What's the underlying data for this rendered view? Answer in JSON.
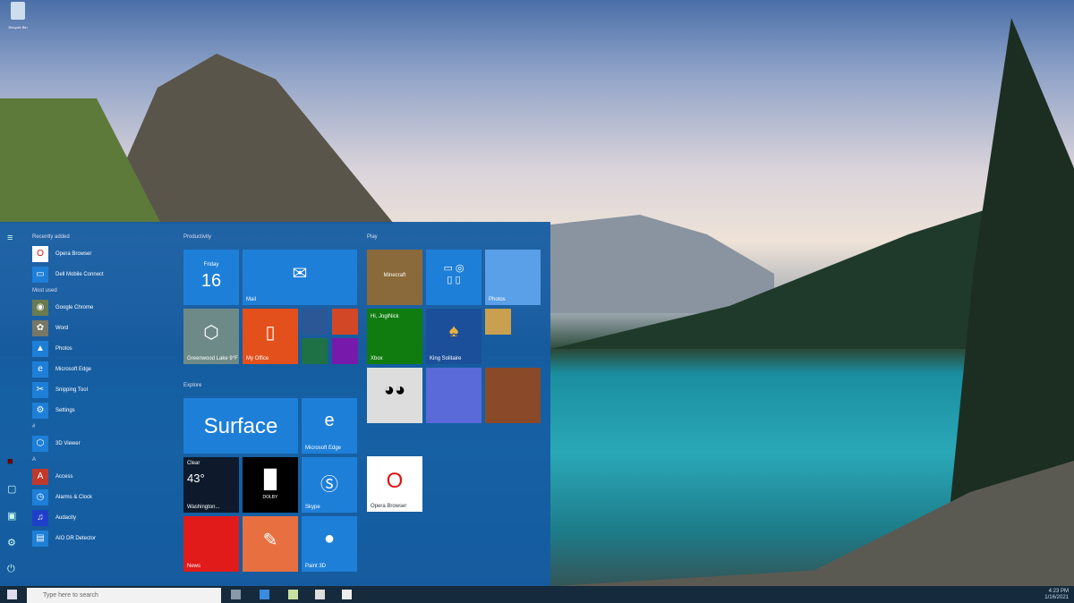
{
  "desktop": {
    "recycle_bin": "Recycle Bin"
  },
  "start_menu": {
    "recently_added_label": "Recently added",
    "recently_added": [
      "Opera Browser",
      "Dell Mobile Connect"
    ],
    "most_used_label": "Most used",
    "most_used": [
      "Google Chrome",
      "Word",
      "Photos",
      "Microsoft Edge",
      "Snipping Tool",
      "Settings"
    ],
    "letter_3": "#",
    "hash_items": [
      "3D Viewer"
    ],
    "letter_a": "A",
    "a_items": [
      "Access",
      "Alarms & Clock",
      "Audacity",
      "AIO DR Detector"
    ],
    "groups": {
      "productivity": "Productivity",
      "explore": "Explore",
      "play": "Play"
    },
    "tiles": {
      "calendar_day": "Friday",
      "calendar_date": "16",
      "mail": "Mail",
      "weather_small": "Greenwood Lake 9°F",
      "office": "My Office",
      "surface": "Surface",
      "edge": "Microsoft Edge",
      "weather_cond": "Clear",
      "weather_temp": "43°",
      "weather_city": "Washington...",
      "dolby": "DOLBY",
      "skype": "Skype",
      "news": "News",
      "paint3d": "Paint 3D",
      "minecraft": "Minecraft",
      "photos": "Photos",
      "xbox_greet": "Hi, JogiNick",
      "xbox": "Xbox",
      "solitaire": "King Solitaire",
      "opera": "Opera Browser"
    }
  },
  "taskbar": {
    "search_placeholder": "Type here to search",
    "time": "4:23 PM",
    "date": "1/16/2021"
  },
  "colors": {
    "start_bg": "#155ca2",
    "tile": "#1e7fd8",
    "office": "#e3501b",
    "news": "#e11a1a",
    "xbox": "#107c10"
  }
}
